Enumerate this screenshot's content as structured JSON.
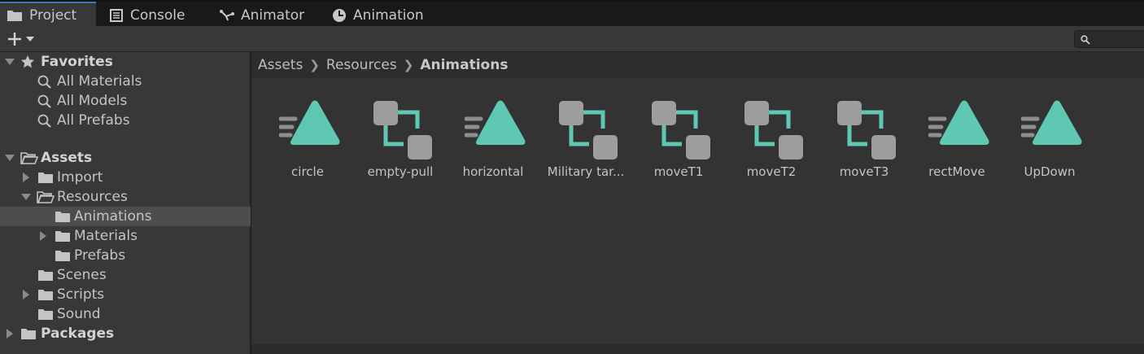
{
  "tabs": [
    {
      "label": "Project",
      "icon": "folder-icon",
      "active": true
    },
    {
      "label": "Console",
      "icon": "console-icon",
      "active": false
    },
    {
      "label": "Animator",
      "icon": "animator-icon",
      "active": false
    },
    {
      "label": "Animation",
      "icon": "clock-icon",
      "active": false
    }
  ],
  "toolbar": {
    "create_icon": "plus-icon",
    "search_placeholder": ""
  },
  "tree": {
    "favorites": {
      "label": "Favorites",
      "items": [
        "All Materials",
        "All Models",
        "All Prefabs"
      ]
    },
    "assets": {
      "label": "Assets",
      "import": "Import",
      "resources": "Resources",
      "animations": "Animations",
      "materials": "Materials",
      "prefabs": "Prefabs",
      "scenes": "Scenes",
      "scripts": "Scripts",
      "sound": "Sound"
    },
    "packages": "Packages"
  },
  "breadcrumb": {
    "part1": "Assets",
    "part2": "Resources",
    "current": "Animations"
  },
  "assets": [
    {
      "name": "circle",
      "type": "animation-clip"
    },
    {
      "name": "empty-pull",
      "type": "animator-controller"
    },
    {
      "name": "horizontal",
      "type": "animation-clip"
    },
    {
      "name": "Military tar...",
      "type": "animator-controller"
    },
    {
      "name": "moveT1",
      "type": "animator-controller"
    },
    {
      "name": "moveT2",
      "type": "animator-controller"
    },
    {
      "name": "moveT3",
      "type": "animator-controller"
    },
    {
      "name": "rectMove",
      "type": "animation-clip"
    },
    {
      "name": "UpDown",
      "type": "animation-clip"
    }
  ],
  "colors": {
    "accent": "#5fc8b4",
    "selection": "#4d4d4d",
    "tab_highlight": "#3a79bb"
  }
}
